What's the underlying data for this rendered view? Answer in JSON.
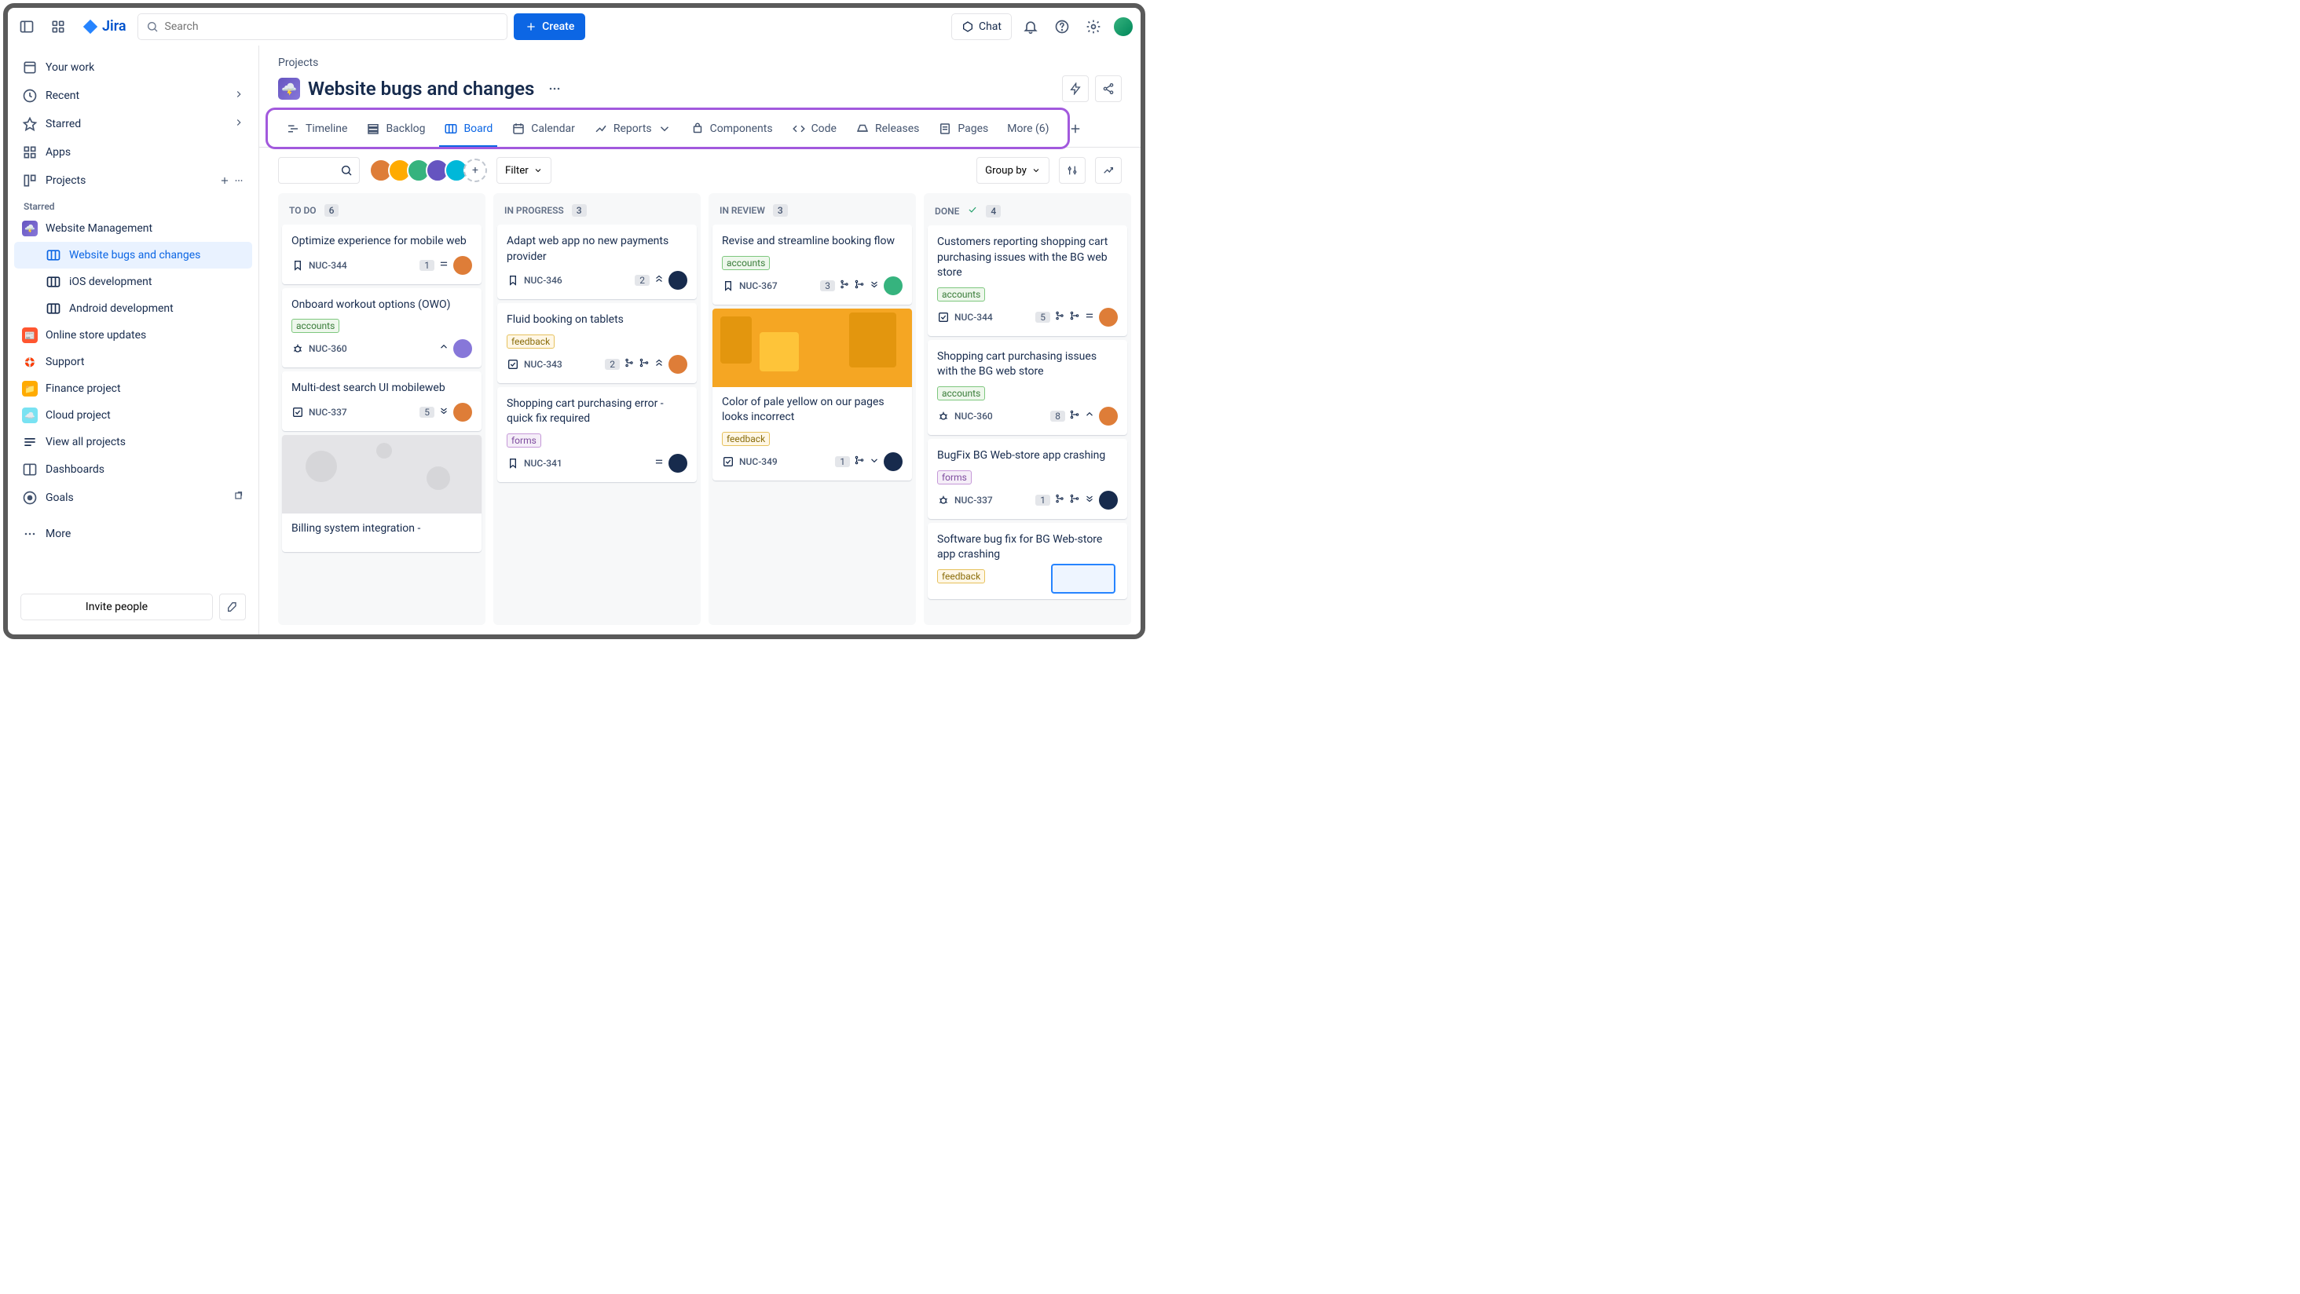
{
  "topbar": {
    "logo": "Jira",
    "search_placeholder": "Search",
    "create": "Create",
    "chat": "Chat"
  },
  "sidebar": {
    "items": [
      {
        "label": "Your work",
        "icon": "inbox"
      },
      {
        "label": "Recent",
        "icon": "clock",
        "chev": true
      },
      {
        "label": "Starred",
        "icon": "star",
        "chev": true
      },
      {
        "label": "Apps",
        "icon": "grid"
      },
      {
        "label": "Projects",
        "icon": "folder",
        "actions": true
      }
    ],
    "starred_hdr": "Starred",
    "wm": "Website Management",
    "subs": [
      {
        "label": "Website bugs and changes",
        "sel": true
      },
      {
        "label": "iOS development"
      },
      {
        "label": "Android development"
      }
    ],
    "projects": [
      {
        "label": "Online store updates",
        "col": "#ff5630"
      },
      {
        "label": "Support",
        "col": "#ff8f73"
      },
      {
        "label": "Finance project",
        "col": "#ffab00"
      },
      {
        "label": "Cloud project",
        "col": "#79e2f2"
      }
    ],
    "view_all": "View all projects",
    "dash": "Dashboards",
    "goals": "Goals",
    "more": "More",
    "invite": "Invite people"
  },
  "header": {
    "crumb": "Projects",
    "title": "Website bugs and changes",
    "tabs": [
      {
        "label": "Timeline",
        "icon": "timeline"
      },
      {
        "label": "Backlog",
        "icon": "backlog"
      },
      {
        "label": "Board",
        "icon": "board",
        "act": true
      },
      {
        "label": "Calendar",
        "icon": "cal"
      },
      {
        "label": "Reports",
        "icon": "rep",
        "caret": true
      },
      {
        "label": "Components",
        "icon": "comp"
      },
      {
        "label": "Code",
        "icon": "code"
      },
      {
        "label": "Releases",
        "icon": "rel"
      },
      {
        "label": "Pages",
        "icon": "pages"
      },
      {
        "label": "More (6)"
      }
    ],
    "filter": "Filter",
    "groupby": "Group by"
  },
  "columns": [
    {
      "name": "TO DO",
      "count": "6",
      "cards": [
        {
          "title": "Optimize experience for mobile web",
          "type": "bm",
          "key": "NUC-344",
          "n": "1",
          "pri": "med",
          "av": "#de7d38"
        },
        {
          "title": "Onboard workout options (OWO)",
          "tag": "accounts",
          "tagc": "acc",
          "type": "bug",
          "key": "NUC-360",
          "pri": "high",
          "av": "#8777d9"
        },
        {
          "title": "Multi-dest search UI mobileweb",
          "type": "task",
          "key": "NUC-337",
          "n": "5",
          "pri": "lows",
          "av": "#de7d38"
        },
        {
          "img": "gray",
          "title": "Billing system integration -"
        }
      ]
    },
    {
      "name": "IN PROGRESS",
      "count": "3",
      "cards": [
        {
          "title": "Adapt web app no new payments provider",
          "type": "bm",
          "key": "NUC-346",
          "n": "2",
          "pri": "vh",
          "av": "#172b4d"
        },
        {
          "title": "Fluid booking on tablets",
          "tag": "feedback",
          "tagc": "fb",
          "type": "task",
          "key": "NUC-343",
          "n": "2",
          "pri": "h2",
          "xi": true,
          "av": "#de7d38"
        },
        {
          "title": "Shopping cart purchasing error - quick fix required",
          "tag": "forms",
          "tagc": "fm",
          "type": "bm",
          "key": "NUC-341",
          "pri": "med",
          "av": "#172b4d"
        }
      ]
    },
    {
      "name": "IN REVIEW",
      "count": "3",
      "cards": [
        {
          "title": "Revise and streamline booking flow",
          "tag": "accounts",
          "tagc": "acc",
          "type": "bm",
          "key": "NUC-367",
          "n": "3",
          "xi": true,
          "pri2": "lows",
          "av": "#36b37e"
        },
        {
          "img": "y",
          "title": "Color of pale yellow on our pages looks incorrect",
          "tag": "feedback",
          "tagc": "fb",
          "type": "task",
          "key": "NUC-349",
          "n": "1",
          "pri2": "low",
          "xi2": true,
          "av": "#172b4d"
        }
      ]
    },
    {
      "name": "DONE",
      "count": "4",
      "done": true,
      "cards": [
        {
          "title": "Customers reporting shopping cart purchasing issues with the BG web store",
          "tag": "accounts",
          "tagc": "acc",
          "type": "task",
          "key": "NUC-344",
          "n": "5",
          "xi": true,
          "pri": "med",
          "av": "#de7d38"
        },
        {
          "title": "Shopping cart purchasing issues with the BG web store",
          "tag": "accounts",
          "tagc": "acc",
          "type": "bug",
          "key": "NUC-360",
          "n": "8",
          "pri": "high",
          "xi2": true,
          "av": "#de7d38"
        },
        {
          "title": "BugFix BG Web-store app crashing",
          "tag": "forms",
          "tagc": "fm",
          "type": "bug",
          "key": "NUC-337",
          "n": "1",
          "xi": true,
          "pri2": "lows",
          "av": "#172b4d"
        },
        {
          "title": "Software bug fix for BG Web-store app crashing",
          "tag": "feedback",
          "tagc": "fb"
        }
      ]
    }
  ]
}
